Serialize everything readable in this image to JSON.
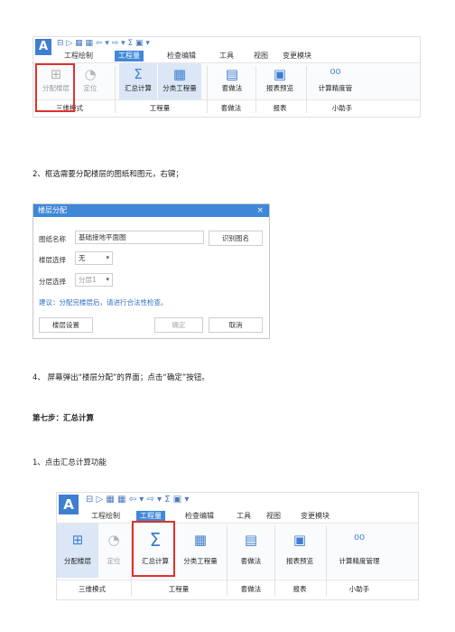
{
  "ribbon": {
    "logo": "A",
    "quick_access": "⊟ ▷ ▦ ▦ ⇦ ▾ ⇨ ▾ Σ ▣ ▾",
    "tabs": [
      "工程绘制",
      "工程量",
      "检查编辑",
      "工具",
      "视图",
      "变更模块"
    ],
    "active_tab": "工程量",
    "buttons": {
      "floor_assign": "分配楼层",
      "locate": "定位",
      "summary_calc": "汇总计算",
      "category_qty": "分类工程量",
      "set_method": "套做法",
      "report_preview": "报表预览",
      "precision_1": "计算精度管",
      "precision_2": "计算精度管理"
    },
    "groups": {
      "mode3d": "三维模式",
      "quantity": "工程量",
      "method": "套做法",
      "report": "报表",
      "helper": "小助手"
    }
  },
  "text": {
    "step2": "2、框选需要分配楼层的图纸和图元，右键；",
    "step4": "4、 屏幕弹出“楼层分配”的界面；点击“确定”按钮。",
    "step7": "第七步：汇总计算",
    "step7_1": "1、点击汇总计算功能"
  },
  "dialog": {
    "title": "楼层分配",
    "close": "×",
    "drawing_name_label": "图纸名称",
    "drawing_name_value": "基础接地平面图",
    "identify_button": "识别图名",
    "floor_select_label": "楼层选择",
    "floor_select_value": "无",
    "layer_select_label": "分层选择",
    "layer_select_value": "分层1",
    "hint": "建议：分配完楼层后，请进行合法性检查。",
    "floor_settings_button": "楼层设置",
    "ok_button": "确定",
    "cancel_button": "取消"
  }
}
